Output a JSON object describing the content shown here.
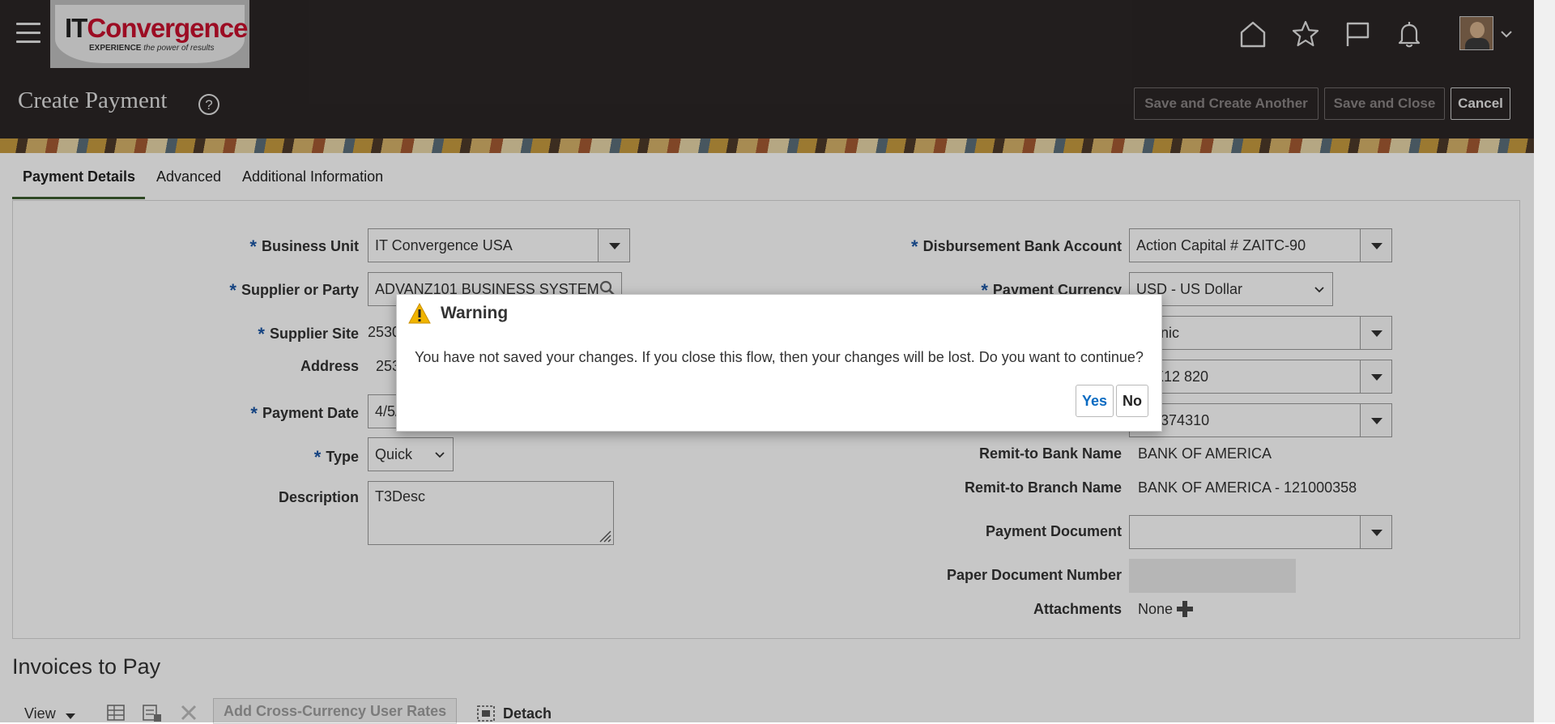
{
  "header": {
    "logo_primary": "IT",
    "logo_accent": "Convergence",
    "logo_tagline_bold": "EXPERIENCE",
    "logo_tagline": " the power of results",
    "page_title": "Create Payment",
    "buttons": {
      "save_create_another": "Save and Create Another",
      "save_close": "Save and Close",
      "cancel": "Cancel"
    },
    "nav_icons": [
      "home-icon",
      "favorites-star-icon",
      "watchlist-flag-icon",
      "notifications-bell-icon"
    ]
  },
  "tabs": [
    {
      "label": "Payment Details",
      "active": true
    },
    {
      "label": "Advanced",
      "active": false
    },
    {
      "label": "Additional Information",
      "active": false
    }
  ],
  "form_left": {
    "business_unit": {
      "label": "Business Unit",
      "value": "IT Convergence USA"
    },
    "supplier": {
      "label": "Supplier or Party",
      "value": "ADVANZ101 BUSINESS SYSTEM"
    },
    "supplier_site": {
      "label": "Supplier Site",
      "value": "2530"
    },
    "address": {
      "label": "Address",
      "value": "253"
    },
    "payment_date": {
      "label": "Payment Date",
      "value": "4/5/"
    },
    "type": {
      "label": "Type",
      "value": "Quick"
    },
    "description": {
      "label": "Description",
      "value": "T3Desc"
    }
  },
  "form_right": {
    "disbursement_bank_account": {
      "label": "Disbursement Bank Account",
      "value": "Action Capital # ZAITC-90"
    },
    "payment_currency": {
      "label": "Payment Currency",
      "value": "USD - US Dollar"
    },
    "payment_method_value": "ctronic",
    "payment_process_profile_value": "SI X12 820",
    "remit_bank_account_value": "100374310",
    "remit_bank_name": {
      "label": "Remit-to Bank Name",
      "value": "BANK OF AMERICA"
    },
    "remit_branch_name": {
      "label": "Remit-to Branch Name",
      "value": "BANK OF AMERICA - 121000358"
    },
    "payment_document": {
      "label": "Payment Document",
      "value": ""
    },
    "paper_document_number": {
      "label": "Paper Document Number",
      "value": ""
    },
    "attachments": {
      "label": "Attachments",
      "value": "None"
    }
  },
  "invoices": {
    "title": "Invoices to Pay",
    "view_label": "View",
    "add_rates_label": "Add Cross-Currency User Rates",
    "detach_label": "Detach"
  },
  "dialog": {
    "title": "Warning",
    "message": "You have not saved your changes. If you close this flow, then your changes will be lost. Do you want to continue?",
    "yes_label": "Yes",
    "no_label": "No"
  },
  "colors": {
    "header_bg": "#2b2626",
    "required_marker": "#1b57a6",
    "active_tab_underline": "#3b5d2f",
    "yes_button_text": "#0b6bc2",
    "warning_icon": "#f0b400"
  }
}
